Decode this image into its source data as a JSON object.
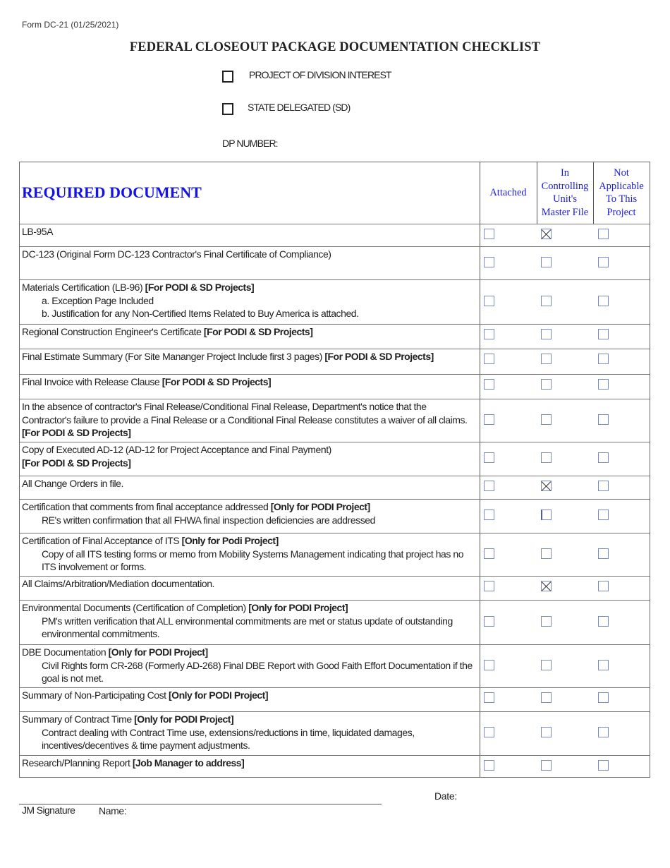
{
  "form_id": "Form DC-21 (01/25/2021)",
  "title": "FEDERAL CLOSEOUT PACKAGE DOCUMENTATION CHECKLIST",
  "project_types": [
    {
      "label": "PROJECT OF DIVISION INTEREST",
      "checked": false
    },
    {
      "label": "STATE DELEGATED (SD)",
      "checked": false
    }
  ],
  "dp_number_label": "DP NUMBER:",
  "table": {
    "header": {
      "document": "REQUIRED DOCUMENT",
      "columns": [
        "Attached",
        "In Controlling Unit's Master File",
        "Not Applicable To This Project"
      ],
      "column_lines": [
        [
          "Attached"
        ],
        [
          "In",
          "Controlling",
          "Unit's",
          "Master File"
        ],
        [
          "Not",
          "Applicable",
          "To This",
          "Project"
        ]
      ]
    },
    "rows": [
      {
        "text": "LB-95A",
        "tag": "",
        "subs": [],
        "checks": [
          false,
          true,
          false
        ]
      },
      {
        "text": "DC-123 (Original Form DC-123 Contractor's Final Certificate of Compliance)",
        "tag": "",
        "subs": [],
        "checks": [
          false,
          false,
          false
        ]
      },
      {
        "text": "Materials Certification (LB-96) ",
        "tag": "[For PODI & SD Projects]",
        "subs": [
          "a.  Exception Page Included",
          "b.   Justification for any Non-Certified Items Related to Buy America is attached."
        ],
        "checks": [
          false,
          false,
          false
        ]
      },
      {
        "text": "Regional Construction Engineer's Certificate ",
        "tag": "[For PODI & SD Projects]",
        "subs": [],
        "checks": [
          false,
          false,
          false
        ]
      },
      {
        "text": "Final Estimate Summary (For Site Mananger Project Include first 3 pages)   ",
        "tag": "[For PODI & SD Projects]",
        "subs": [],
        "checks": [
          false,
          false,
          false
        ]
      },
      {
        "text": "Final Invoice with Release Clause ",
        "tag": "[For PODI & SD Projects]",
        "subs": [],
        "checks": [
          false,
          false,
          false
        ]
      },
      {
        "text": "In the absence of contractor's Final Release/Conditional Final Release, Department's notice that the Contractor's failure to provide a Final Release or a Conditional Final Release constitutes a waiver of all claims. ",
        "tag": "[For PODI & SD Projects]",
        "subs": [],
        "checks": [
          false,
          false,
          false
        ]
      },
      {
        "text": "Copy of Executed AD-12 (AD-12 for Project Acceptance and Final Payment)",
        "tag": "[For PODI & SD Projects]",
        "tag_newline": true,
        "subs": [],
        "checks": [
          false,
          false,
          false
        ]
      },
      {
        "text": "All Change Orders in file.",
        "tag": "",
        "subs": [],
        "checks": [
          false,
          true,
          false
        ]
      },
      {
        "text": "Certification that comments from final acceptance addressed ",
        "tag": "[Only for PODI Project]",
        "subs": [
          "RE's written confirmation that all FHWA final inspection deficiencies are addressed"
        ],
        "checks": [
          false,
          false,
          false
        ]
      },
      {
        "text": "Certification of Final Acceptance of ITS ",
        "tag": "[Only for Podi Project]",
        "subs": [
          "Copy of all ITS testing forms or memo from Mobility Systems Management indicating that project has no ITS involvement or forms."
        ],
        "checks": [
          false,
          false,
          false
        ]
      },
      {
        "text": "All Claims/Arbitration/Mediation documentation.",
        "tag": "",
        "subs": [],
        "checks": [
          false,
          true,
          false
        ]
      },
      {
        "text": "Environmental Documents (Certification of Completion) ",
        "tag": "[Only for PODI Project]",
        "subs": [
          "PM's written verification that ALL environmental commitments are met or status update of outstanding environmental commitments."
        ],
        "checks": [
          false,
          false,
          false
        ]
      },
      {
        "text": "DBE Documentation ",
        "tag": "[Only for PODI Project]",
        "subs": [
          "Civil Rights form CR-268 (Formerly AD-268) Final DBE Report with Good Faith Effort Documentation if the goal is not met."
        ],
        "checks": [
          false,
          false,
          false
        ]
      },
      {
        "text": "Summary of Non-Participating Cost ",
        "tag": "[Only for PODI Project]",
        "subs": [],
        "checks": [
          false,
          false,
          false
        ]
      },
      {
        "text": "Summary of Contract Time ",
        "tag": "[Only for PODI Project]",
        "subs": [
          "Contract dealing with Contract Time use, extensions/reductions in time, liquidated damages, incentives/decentives & time payment adjustments."
        ],
        "checks": [
          false,
          false,
          false
        ]
      },
      {
        "text": "Research/Planning Report ",
        "tag": "[Job Manager to address]",
        "subs": [],
        "checks": [
          false,
          false,
          false
        ]
      }
    ]
  },
  "footer": {
    "date_label": "Date:",
    "signature_label": "JM Signature",
    "name_label": "Name:"
  }
}
